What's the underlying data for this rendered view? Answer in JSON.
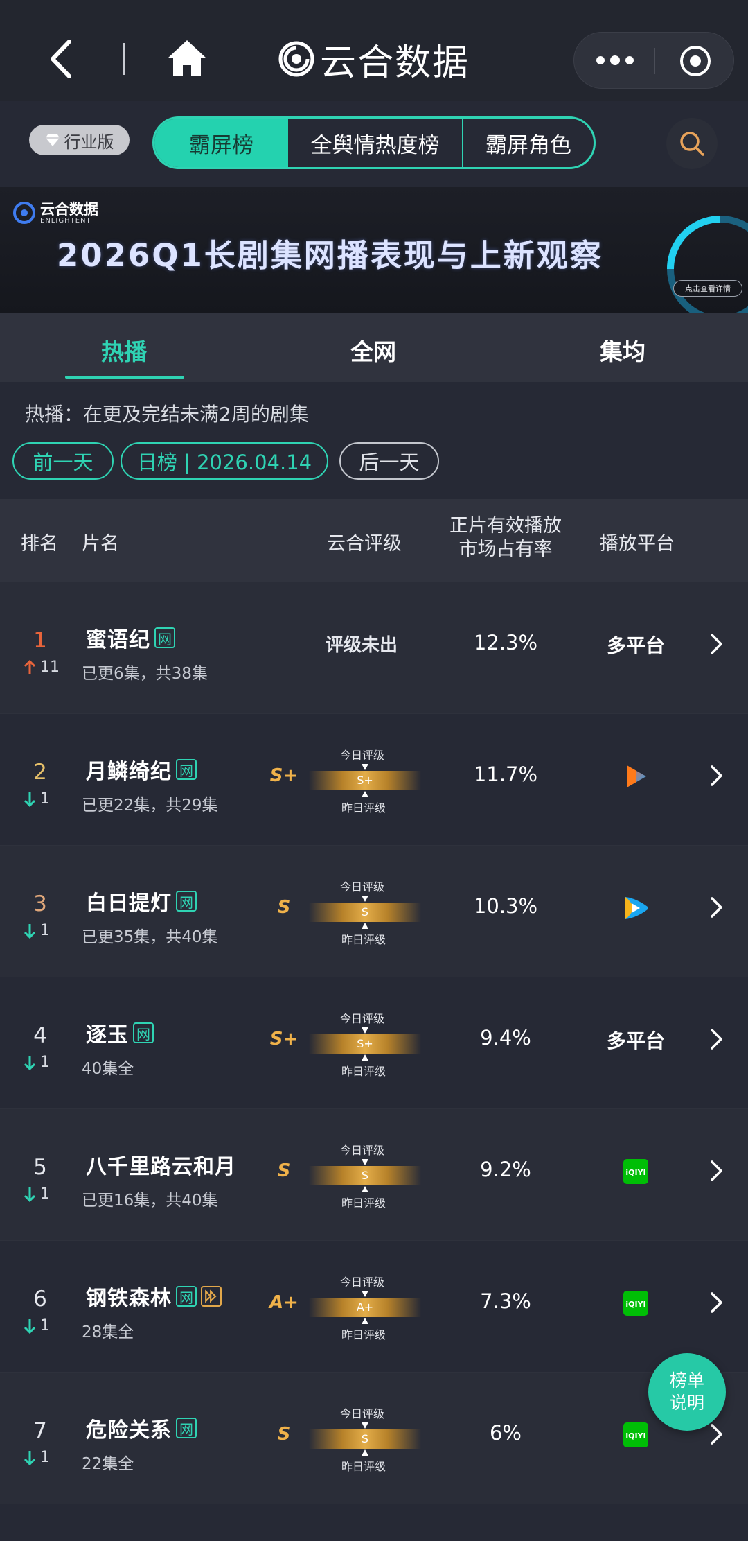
{
  "nav": {
    "brand": "云合数据"
  },
  "toolbar": {
    "edition_label": "行业版",
    "tabs": [
      {
        "label": "霸屏榜",
        "active": true
      },
      {
        "label": "全舆情热度榜",
        "active": false
      },
      {
        "label": "霸屏角色",
        "active": false
      }
    ]
  },
  "banner": {
    "logo_cn": "云合数据",
    "logo_en": "ENLIGHTENT",
    "title": "2026Q1长剧集网播表现与上新观察",
    "cta": "点击查看详情"
  },
  "subtabs": [
    {
      "label": "热播",
      "active": true
    },
    {
      "label": "全网",
      "active": false
    },
    {
      "label": "集均",
      "active": false
    }
  ],
  "note": "热播：在更及完结未满2周的剧集",
  "date_nav": {
    "prev": "前一天",
    "current": "日榜 | 2026.04.14",
    "next": "后一天"
  },
  "table": {
    "headers": {
      "rank": "排名",
      "title": "片名",
      "grade": "云合评级",
      "share_line1": "正片有效播放",
      "share_line2": "市场占有率",
      "platform": "播放平台"
    },
    "grade_today_label": "今日评级",
    "grade_yesterday_label": "昨日评级",
    "rows": [
      {
        "rank": "1",
        "trend": "up",
        "trend_value": "11",
        "title": "蜜语纪",
        "tag": "网",
        "episodes": "已更6集，共38集",
        "grade_status": "评级未出",
        "grade": "",
        "share": "12.3%",
        "platform": "多平台",
        "platform_icon": ""
      },
      {
        "rank": "2",
        "trend": "down",
        "trend_value": "1",
        "title": "月鳞绮纪",
        "tag": "网",
        "episodes": "已更22集，共29集",
        "grade_status": "",
        "grade": "S+",
        "share": "11.7%",
        "platform": "",
        "platform_icon": "youku-icon"
      },
      {
        "rank": "3",
        "trend": "down",
        "trend_value": "1",
        "title": "白日提灯",
        "tag": "网",
        "episodes": "已更35集，共40集",
        "grade_status": "",
        "grade": "S",
        "share": "10.3%",
        "platform": "",
        "platform_icon": "tencent-video-icon"
      },
      {
        "rank": "4",
        "trend": "down",
        "trend_value": "1",
        "title": "逐玉",
        "tag": "网",
        "episodes": "40集全",
        "grade_status": "",
        "grade": "S+",
        "share": "9.4%",
        "platform": "多平台",
        "platform_icon": ""
      },
      {
        "rank": "5",
        "trend": "down",
        "trend_value": "1",
        "title": "八千里路云和月",
        "tag": "",
        "episodes": "已更16集，共40集",
        "grade_status": "",
        "grade": "S",
        "share": "9.2%",
        "platform": "",
        "platform_icon": "iqiyi-icon"
      },
      {
        "rank": "6",
        "trend": "down",
        "trend_value": "1",
        "title": "钢铁森林",
        "tag": "网",
        "episodes": "28集全",
        "grade_status": "",
        "grade": "A+",
        "share": "7.3%",
        "platform": "",
        "platform_icon": "iqiyi-icon"
      },
      {
        "rank": "7",
        "trend": "down",
        "trend_value": "1",
        "title": "危险关系",
        "tag": "网",
        "episodes": "22集全",
        "grade_status": "",
        "grade": "S",
        "share": "6%",
        "platform": "",
        "platform_icon": "iqiyi-icon"
      }
    ]
  },
  "fab": {
    "line1": "榜单",
    "line2": "说明"
  },
  "colors": {
    "accent": "#2fd3b3",
    "background": "#262935",
    "grade_gold": "#f0b24a",
    "trend_up": "#e8643b",
    "trend_down": "#2fd3b3"
  }
}
